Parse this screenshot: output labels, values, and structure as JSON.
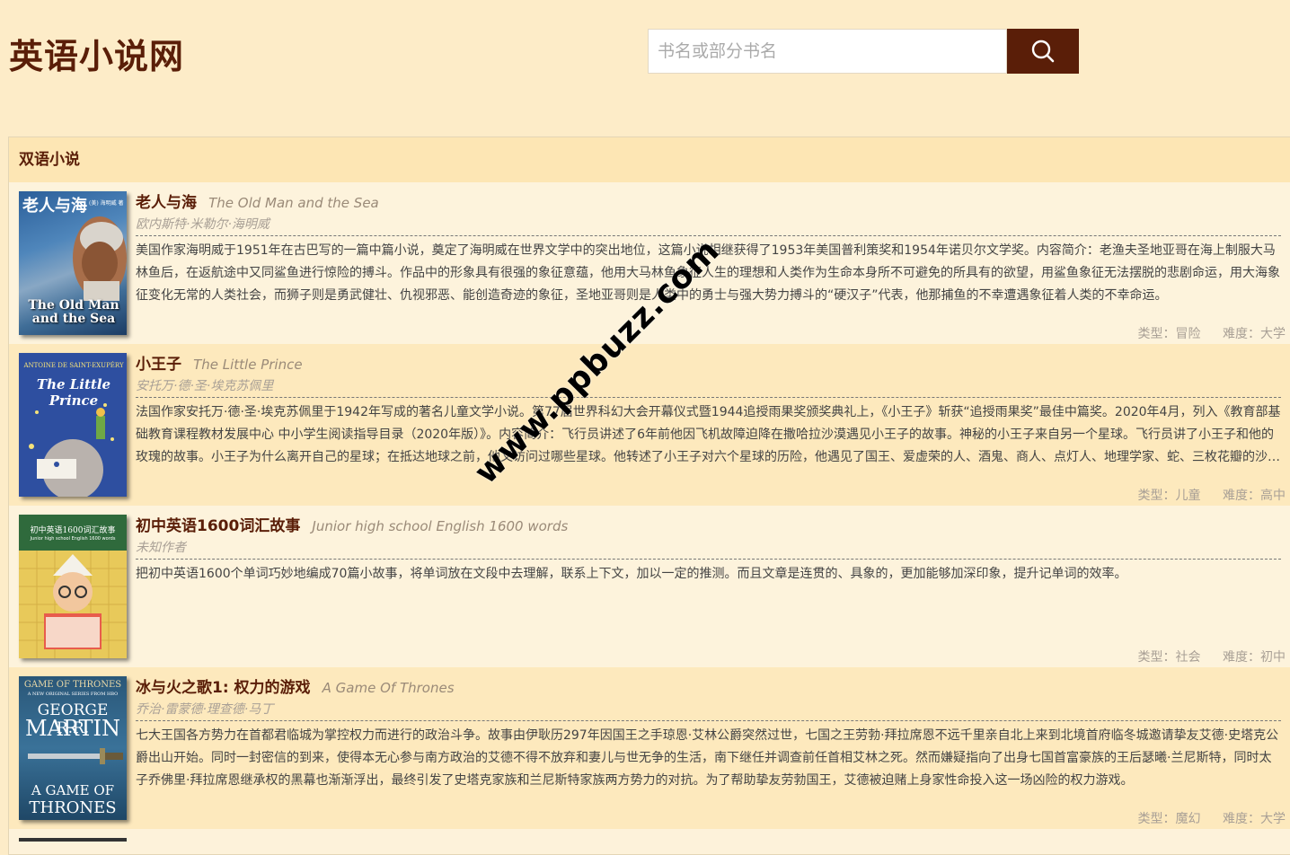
{
  "site": {
    "title": "英语小说网"
  },
  "search": {
    "placeholder": "书名或部分书名",
    "button_icon": "search-icon"
  },
  "section": {
    "title": "双语小说"
  },
  "books": [
    {
      "title_cn": "老人与海",
      "title_en": "The Old Man and the Sea",
      "author": "欧内斯特·米勒尔·海明威",
      "description": "美国作家海明威于1951年在古巴写的一篇中篇小说，奠定了海明威在世界文学中的突出地位，这篇小说相继获得了1953年美国普利策奖和1954年诺贝尔文学奖。内容简介：老渔夫圣地亚哥在海上制服大马林鱼后，在返航途中又同鲨鱼进行惊险的搏斗。作品中的形象具有很强的象征意蕴，他用大马林鱼象征人生的理想和人类作为生命本身所不可避免的所具有的欲望，用鲨鱼象征无法摆脱的悲剧命运，用大海象征变化无常的人类社会，而狮子则是勇武健壮、仇视邪恶、能创造奇迹的象征，圣地亚哥则是人类中的勇士与强大势力搏斗的“硬汉子”代表，他那捕鱼的不幸遭遇象征着人类的不幸命运。",
      "type_label": "类型：冒险",
      "level_label": "难度：大学",
      "cover": {
        "title_cn": "老人与海",
        "title_en": "The Old Man and the Sea",
        "small": "(美) 海明威 著"
      }
    },
    {
      "title_cn": "小王子",
      "title_en": "The Little Prince",
      "author": "安托万·德·圣·埃克苏佩里",
      "description": "法国作家安托万·德·圣·埃克苏佩里于1942年写成的著名儿童文学小说。第77届世界科幻大会开幕仪式暨1944追授雨果奖颁奖典礼上，《小王子》斩获“追授雨果奖”最佳中篇奖。2020年4月，列入《教育部基础教育课程教材发展中心 中小学生阅读指导目录（2020年版）》。内容简介：飞行员讲述了6年前他因飞机故障迫降在撒哈拉沙漠遇见小王子的故事。神秘的小王子来自另一个星球。飞行员讲了小王子和他的玫瑰的故事。小王子为什么离开自己的星球；在抵达地球之前，他又访问过哪些星球。他转述了小王子对六个星球的历险，他遇见了国王、爱虚荣的人、酒鬼、商人、点灯人、地理学家、蛇、三枚花瓣的沙漠花。",
      "type_label": "类型：儿童",
      "level_label": "难度：高中",
      "cover": {
        "author": "ANTOINE DE SAINT-EXUPÉRY",
        "title": "The Little Prince"
      }
    },
    {
      "title_cn": "初中英语1600词汇故事",
      "title_en": "Junior high school English 1600 words",
      "author": "未知作者",
      "description": "把初中英语1600个单词巧妙地编成70篇小故事，将单词放在文段中去理解，联系上下文，加以一定的推测。而且文章是连贯的、具象的，更加能够加深印象，提升记单词的效率。",
      "type_label": "类型：社会",
      "level_label": "难度：初中",
      "cover": {
        "title_cn": "初中英语1600词汇故事",
        "title_en": "Junior high school English 1600 words"
      }
    },
    {
      "title_cn": "冰与火之歌1: 权力的游戏",
      "title_en": "A Game Of Thrones",
      "author": "乔治·雷蒙德·理查德·马丁",
      "description": "七大王国各方势力在首都君临城为掌控权力而进行的政治斗争。故事由伊耿历297年因国王之手琼恩·艾林公爵突然过世，七国之王劳勃·拜拉席恩不远千里亲自北上来到北境首府临冬城邀请挚友艾德·史塔克公爵出山开始。同时一封密信的到来，使得本无心参与南方政治的艾德不得不放弃和妻儿与世无争的生活，南下继任并调查前任首相艾林之死。然而嫌疑指向了出身七国首富豪族的王后瑟曦·兰尼斯特，同时太子乔佛里·拜拉席恩继承权的黑幕也渐渐浮出，最终引发了史塔克家族和兰尼斯特家族两方势力的对抗。为了帮助挚友劳勃国王，艾德被迫赌上身家性命投入这一场凶险的权力游戏。",
      "type_label": "类型：魔幻",
      "level_label": "难度：大学",
      "cover": {
        "top": "GAME OF THRONES",
        "series": "A NEW ORIGINAL SERIES FROM HBO",
        "author1": "GEORGE R.R.",
        "author2": "MARTIN",
        "title1": "A GAME OF",
        "title2": "THRONES"
      }
    }
  ],
  "watermark": "www.ppbuzz.com",
  "colors": {
    "background": "#fdecc8",
    "brand": "#5a1e08",
    "row_light": "#fdf3dc",
    "row_dark": "#fde9bd"
  }
}
